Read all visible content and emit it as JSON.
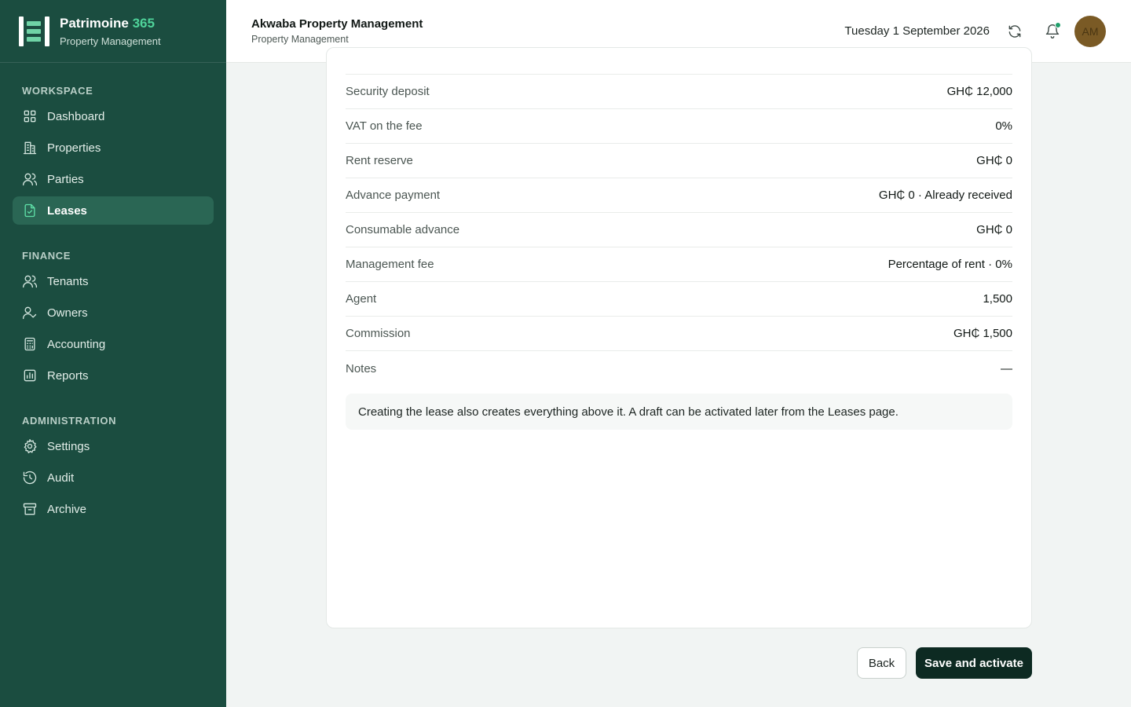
{
  "brand": {
    "name": "Patrimoine",
    "name_accent": "365",
    "subtitle": "Property Management"
  },
  "sidebar": {
    "sections": [
      {
        "heading": "WORKSPACE",
        "items": [
          {
            "label": "Dashboard",
            "icon": "grid-icon"
          },
          {
            "label": "Properties",
            "icon": "building-icon"
          },
          {
            "label": "Parties",
            "icon": "users-icon"
          },
          {
            "label": "Leases",
            "icon": "file-check-icon",
            "active": true
          }
        ]
      },
      {
        "heading": "FINANCE",
        "items": [
          {
            "label": "Tenants",
            "icon": "users-icon"
          },
          {
            "label": "Owners",
            "icon": "user-check-icon"
          },
          {
            "label": "Accounting",
            "icon": "calculator-icon"
          },
          {
            "label": "Reports",
            "icon": "bar-chart-icon"
          }
        ]
      },
      {
        "heading": "ADMINISTRATION",
        "items": [
          {
            "label": "Settings",
            "icon": "gear-icon"
          },
          {
            "label": "Audit",
            "icon": "history-icon"
          },
          {
            "label": "Archive",
            "icon": "archive-icon"
          }
        ]
      }
    ]
  },
  "header": {
    "org_name": "Akwaba Property Management",
    "org_sub": "Property Management",
    "date": "Tuesday 1 September 2026",
    "avatar_initials": "AM"
  },
  "summary": {
    "rows": [
      {
        "label": "Security deposit",
        "value": "GH₵ 12,000"
      },
      {
        "label": "VAT on the fee",
        "value": "0%"
      },
      {
        "label": "Rent reserve",
        "value": "GH₵ 0"
      },
      {
        "label": "Advance payment",
        "value": "GH₵ 0 · Already received"
      },
      {
        "label": "Consumable advance",
        "value": "GH₵ 0"
      },
      {
        "label": "Management fee",
        "value": "Percentage of rent · 0%"
      },
      {
        "label": "Agent",
        "value": "1,500"
      },
      {
        "label": "Commission",
        "value": "GH₵ 1,500"
      },
      {
        "label": "Notes",
        "value": "—"
      }
    ],
    "note": "Creating the lease also creates everything above it. A draft can be activated later from the Leases page."
  },
  "actions": {
    "back_label": "Back",
    "save_label": "Save and activate"
  },
  "colors": {
    "sidebar": "#1b4d40",
    "active_item": "#2a6654",
    "accent": "#4fd39a",
    "primary_button": "#0d2a22"
  }
}
